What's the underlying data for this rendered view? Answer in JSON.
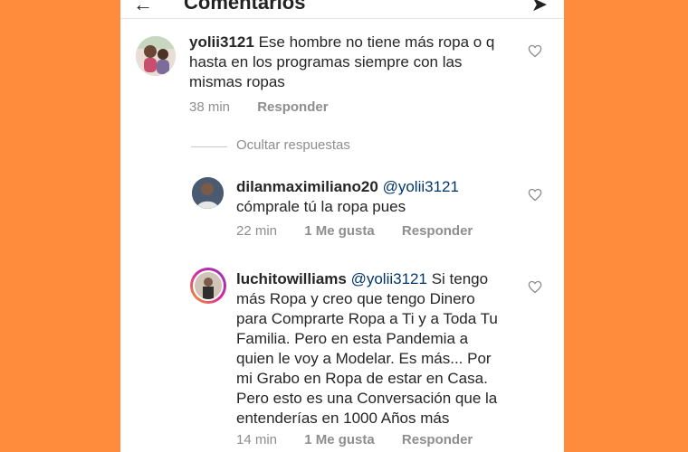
{
  "header": {
    "title": "Comentarios"
  },
  "comments": [
    {
      "user": "yolii3121",
      "text": "Ese hombre no tiene más ropa o q hasta en los programas siempre con las mismas ropas",
      "time": "38 min",
      "reply": "Responder"
    }
  ],
  "hide_replies_label": "Ocultar respuestas",
  "replies": [
    {
      "user": "dilanmaximiliano20",
      "mention": "@yolii3121",
      "text": "cómprale tú  la ropa pues",
      "time": "22 min",
      "likes": "1 Me gusta",
      "reply": "Responder"
    },
    {
      "user": "luchitowilliams",
      "mention": "@yolii3121",
      "text": "Si tengo más Ropa y creo que tengo Dinero para Comprarte Ropa a Ti y a Toda Tu Familia. Pero en esta Pandemia a quien le voy a Modelar. Es más... Por mi Grabo en Ropa de estar en Casa. Pero esto es una Conversación que la entenderías  en 1000 Años más",
      "time": "14 min",
      "likes": "1 Me gusta",
      "reply": "Responder"
    }
  ],
  "colors": {
    "background": "#ff8c3d",
    "text": "#262626",
    "muted": "#8e8e8e",
    "mention": "#00376b"
  }
}
